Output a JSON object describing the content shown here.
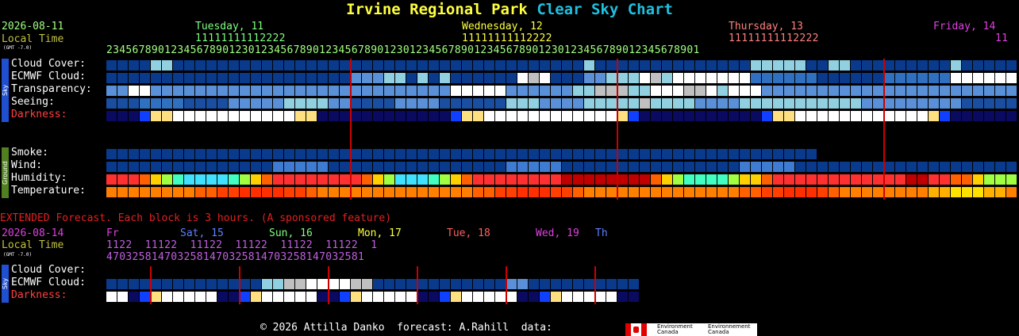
{
  "header": {
    "title_site": "Irvine Regional Park",
    "title_chart": "Clear Sky Chart"
  },
  "main": {
    "date": "2026-08-11",
    "local_time": "Local Time",
    "gmt": "(GMT -7.0)",
    "days": [
      {
        "label": "Tuesday, 11",
        "color": "#80ff80"
      },
      {
        "label": "Wednesday, 12",
        "color": "#ffff40"
      },
      {
        "label": "Thursday, 13",
        "color": "#ff8080"
      },
      {
        "label": "Friday, 14",
        "color": "#e040e0"
      }
    ],
    "tens_rows": [
      "11111111112222",
      "11111111112222",
      "11111111112222",
      "11"
    ],
    "hours": "23456789012345678901230123456789012345678901230123456789012345678901230123456789012345678901",
    "rows": [
      {
        "label": "Cloud Cover:",
        "color": "#ffffff"
      },
      {
        "label": "ECMWF Cloud:",
        "color": "#ffffff"
      },
      {
        "label": "Transparency:",
        "color": "#ffffff"
      },
      {
        "label": "Seeing:",
        "color": "#ffffff"
      },
      {
        "label": "Darkness:",
        "color": "#ff4040"
      }
    ],
    "ground_rows": [
      {
        "label": "Smoke:",
        "color": "#ffffff"
      },
      {
        "label": "Wind:",
        "color": "#ffffff"
      },
      {
        "label": "Humidity:",
        "color": "#ffffff"
      },
      {
        "label": "Temperature:",
        "color": "#ffffff"
      }
    ],
    "sky_side": "Sky",
    "ground_side": "Ground"
  },
  "extended": {
    "title": "EXTENDED Forecast. Each block is 3 hours. (A sponsored feature)",
    "date": "2026-08-14",
    "local_time": "Local Time",
    "gmt": "(GMT -7.0)",
    "days": [
      {
        "label": "Fr",
        "color": "#e040e0"
      },
      {
        "label": "Sat, 15",
        "color": "#6080ff"
      },
      {
        "label": "Sun, 16",
        "color": "#80ff80"
      },
      {
        "label": "Mon, 17",
        "color": "#ffff40"
      },
      {
        "label": "Tue, 18",
        "color": "#ff6060"
      },
      {
        "label": "Wed, 19",
        "color": "#e040e0"
      },
      {
        "label": "Th",
        "color": "#6080ff"
      }
    ],
    "tens": "1122  11122  11122  11122  11122  11122  1",
    "hours": "4703258147032581470325814703258147032581",
    "rows": [
      {
        "label": "Cloud Cover:",
        "color": "#ffffff"
      },
      {
        "label": "ECMWF Cloud:",
        "color": "#ffffff"
      },
      {
        "label": "Darkness:",
        "color": "#ff4040"
      }
    ],
    "sky_side": "Sky"
  },
  "footer": {
    "text": "© 2026 Attilla Danko  forecast: A.Rahill  data:",
    "env1": "Environment Canada",
    "env2": "Environnement Canada"
  },
  "colors": {
    "title_site": "#ffff40",
    "title_chart": "#20c0e0",
    "date": "#a0ff80",
    "local_time": "#c0c040"
  }
}
